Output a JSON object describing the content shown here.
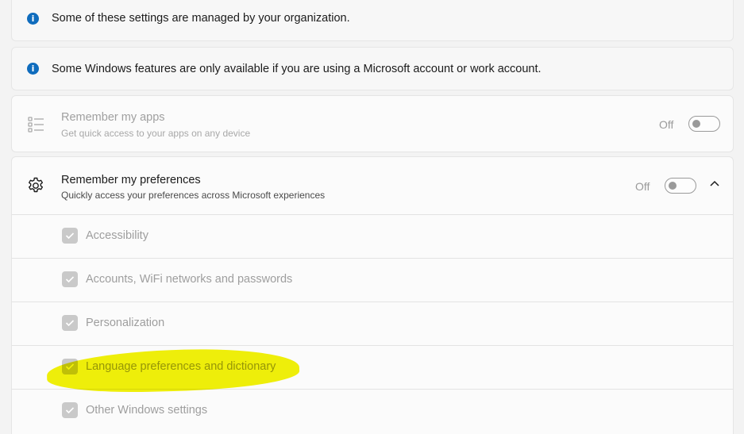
{
  "banners": [
    {
      "text": "Some of these settings are managed by your organization.",
      "icon": "info-icon"
    },
    {
      "text": "Some Windows features are only available if you are using a Microsoft account or work account.",
      "icon": "info-icon"
    }
  ],
  "remember_apps": {
    "title": "Remember my apps",
    "description": "Get quick access to your apps on any device",
    "toggle_state": "Off",
    "icon": "app-list-icon"
  },
  "remember_preferences": {
    "title": "Remember my preferences",
    "description": "Quickly access your preferences across Microsoft experiences",
    "toggle_state": "Off",
    "icon": "gear-icon",
    "expanded": true,
    "items": [
      {
        "label": "Accessibility",
        "checked": true
      },
      {
        "label": "Accounts, WiFi networks and passwords",
        "checked": true
      },
      {
        "label": "Personalization",
        "checked": true
      },
      {
        "label": "Language preferences and dictionary",
        "checked": true,
        "highlighted": true
      },
      {
        "label": "Other Windows settings",
        "checked": true
      }
    ]
  },
  "colors": {
    "info_icon": "#0f6cbd",
    "highlight": "#f2f20a",
    "disabled_text": "#9e9e9e"
  }
}
